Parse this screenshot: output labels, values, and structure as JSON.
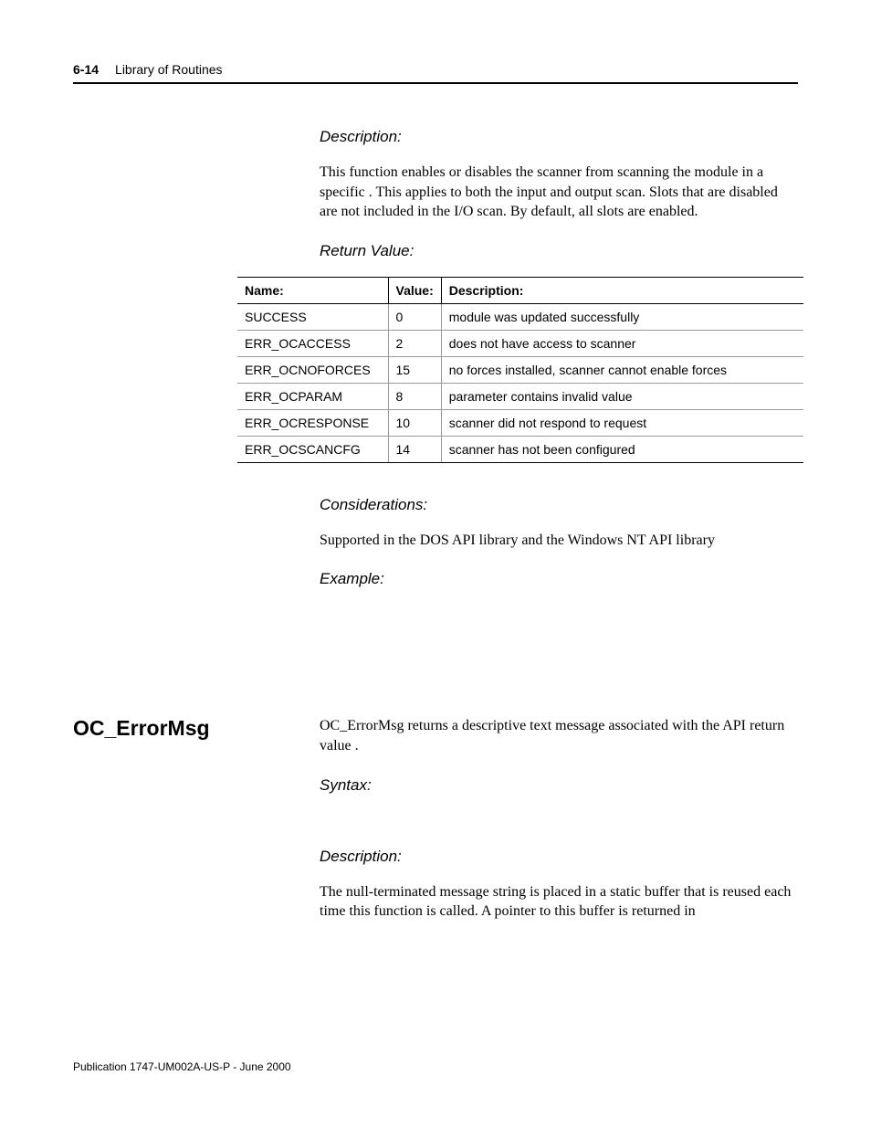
{
  "header": {
    "page": "6-14",
    "title": "Library of Routines"
  },
  "desc1": {
    "label": "Description:",
    "text": "This function enables or disables the scanner from scanning the module in a specific             . This applies to both the input and output scan. Slots that are disabled are not included in the I/O scan. By default, all slots are enabled."
  },
  "retval": {
    "label": "Return Value:",
    "cols": {
      "name": "Name:",
      "value": "Value:",
      "desc": "Description:"
    },
    "rows": [
      {
        "name": "SUCCESS",
        "value": "0",
        "desc": "module was updated successfully"
      },
      {
        "name": "ERR_OCACCESS",
        "value": "2",
        "desc": "             does not have access to scanner"
      },
      {
        "name": "ERR_OCNOFORCES",
        "value": "15",
        "desc": "no forces installed, scanner cannot enable forces"
      },
      {
        "name": "ERR_OCPARAM",
        "value": "8",
        "desc": "parameter contains invalid value"
      },
      {
        "name": "ERR_OCRESPONSE",
        "value": "10",
        "desc": "scanner did not respond to request"
      },
      {
        "name": "ERR_OCSCANCFG",
        "value": "14",
        "desc": "scanner has not been configured"
      }
    ]
  },
  "considerations": {
    "label": "Considerations:",
    "text": "Supported in the DOS API library and the Windows NT API library"
  },
  "example": {
    "label": "Example:"
  },
  "section2": {
    "heading": "OC_ErrorMsg",
    "intro": "OC_ErrorMsg returns a descriptive text message associated with the API return value                .",
    "syntax_label": "Syntax:",
    "desc_label": "Description:",
    "desc_text": "The null-terminated message string is placed in a static buffer that is reused each time this function is called. A pointer to this buffer is returned in"
  },
  "footer": "Publication 1747-UM002A-US-P - June 2000"
}
